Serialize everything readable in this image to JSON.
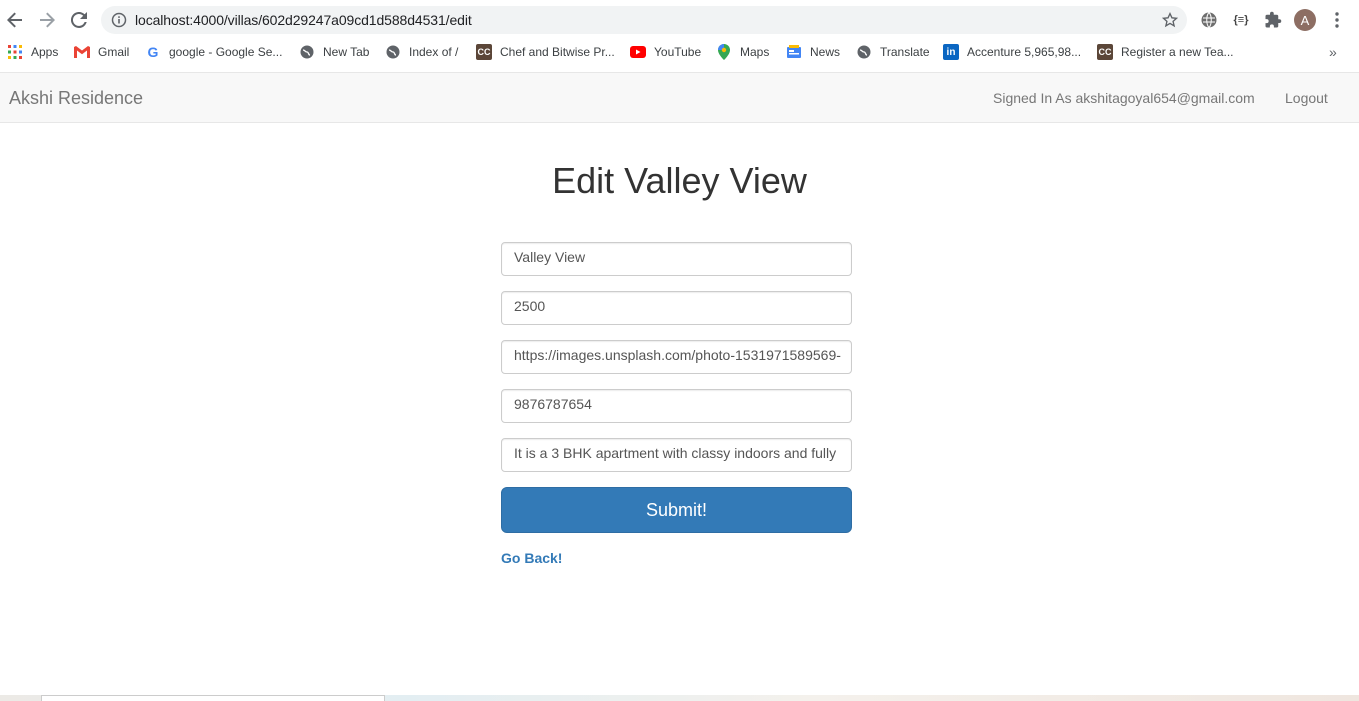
{
  "browser": {
    "url": "localhost:4000/villas/602d29247a09cd1d588d4531/edit",
    "avatar_letter": "A",
    "bookmarks": [
      {
        "label": "Apps",
        "icon": "apps-grid-icon"
      },
      {
        "label": "Gmail",
        "icon": "gmail-icon"
      },
      {
        "label": "google - Google Se...",
        "icon": "google-icon"
      },
      {
        "label": "New Tab",
        "icon": "globe-icon"
      },
      {
        "label": "Index of /",
        "icon": "globe-icon"
      },
      {
        "label": "Chef and Bitwise Pr...",
        "icon": "codechef-icon"
      },
      {
        "label": "YouTube",
        "icon": "youtube-icon"
      },
      {
        "label": "Maps",
        "icon": "maps-pin-icon"
      },
      {
        "label": "News",
        "icon": "news-icon"
      },
      {
        "label": "Translate",
        "icon": "globe-icon"
      },
      {
        "label": "Accenture 5,965,98...",
        "icon": "linkedin-icon"
      },
      {
        "label": "Register a new Tea...",
        "icon": "codechef-icon"
      }
    ],
    "more_label": "»"
  },
  "navbar": {
    "brand": "Akshi Residence",
    "signed_in": "Signed In As akshitagoyal654@gmail.com",
    "logout": "Logout"
  },
  "form": {
    "title": "Edit Valley View",
    "name_value": "Valley View",
    "price_value": "2500",
    "image_value": "https://images.unsplash.com/photo-1531971589569-",
    "phone_value": "9876787654",
    "description_value": "It is a 3 BHK apartment with classy indoors and fully",
    "submit_label": "Submit!",
    "go_back_label": "Go Back!"
  },
  "colors": {
    "primary": "#337ab7",
    "navbar_bg": "#f8f8f8",
    "omnibox_bg": "#f1f3f4"
  }
}
